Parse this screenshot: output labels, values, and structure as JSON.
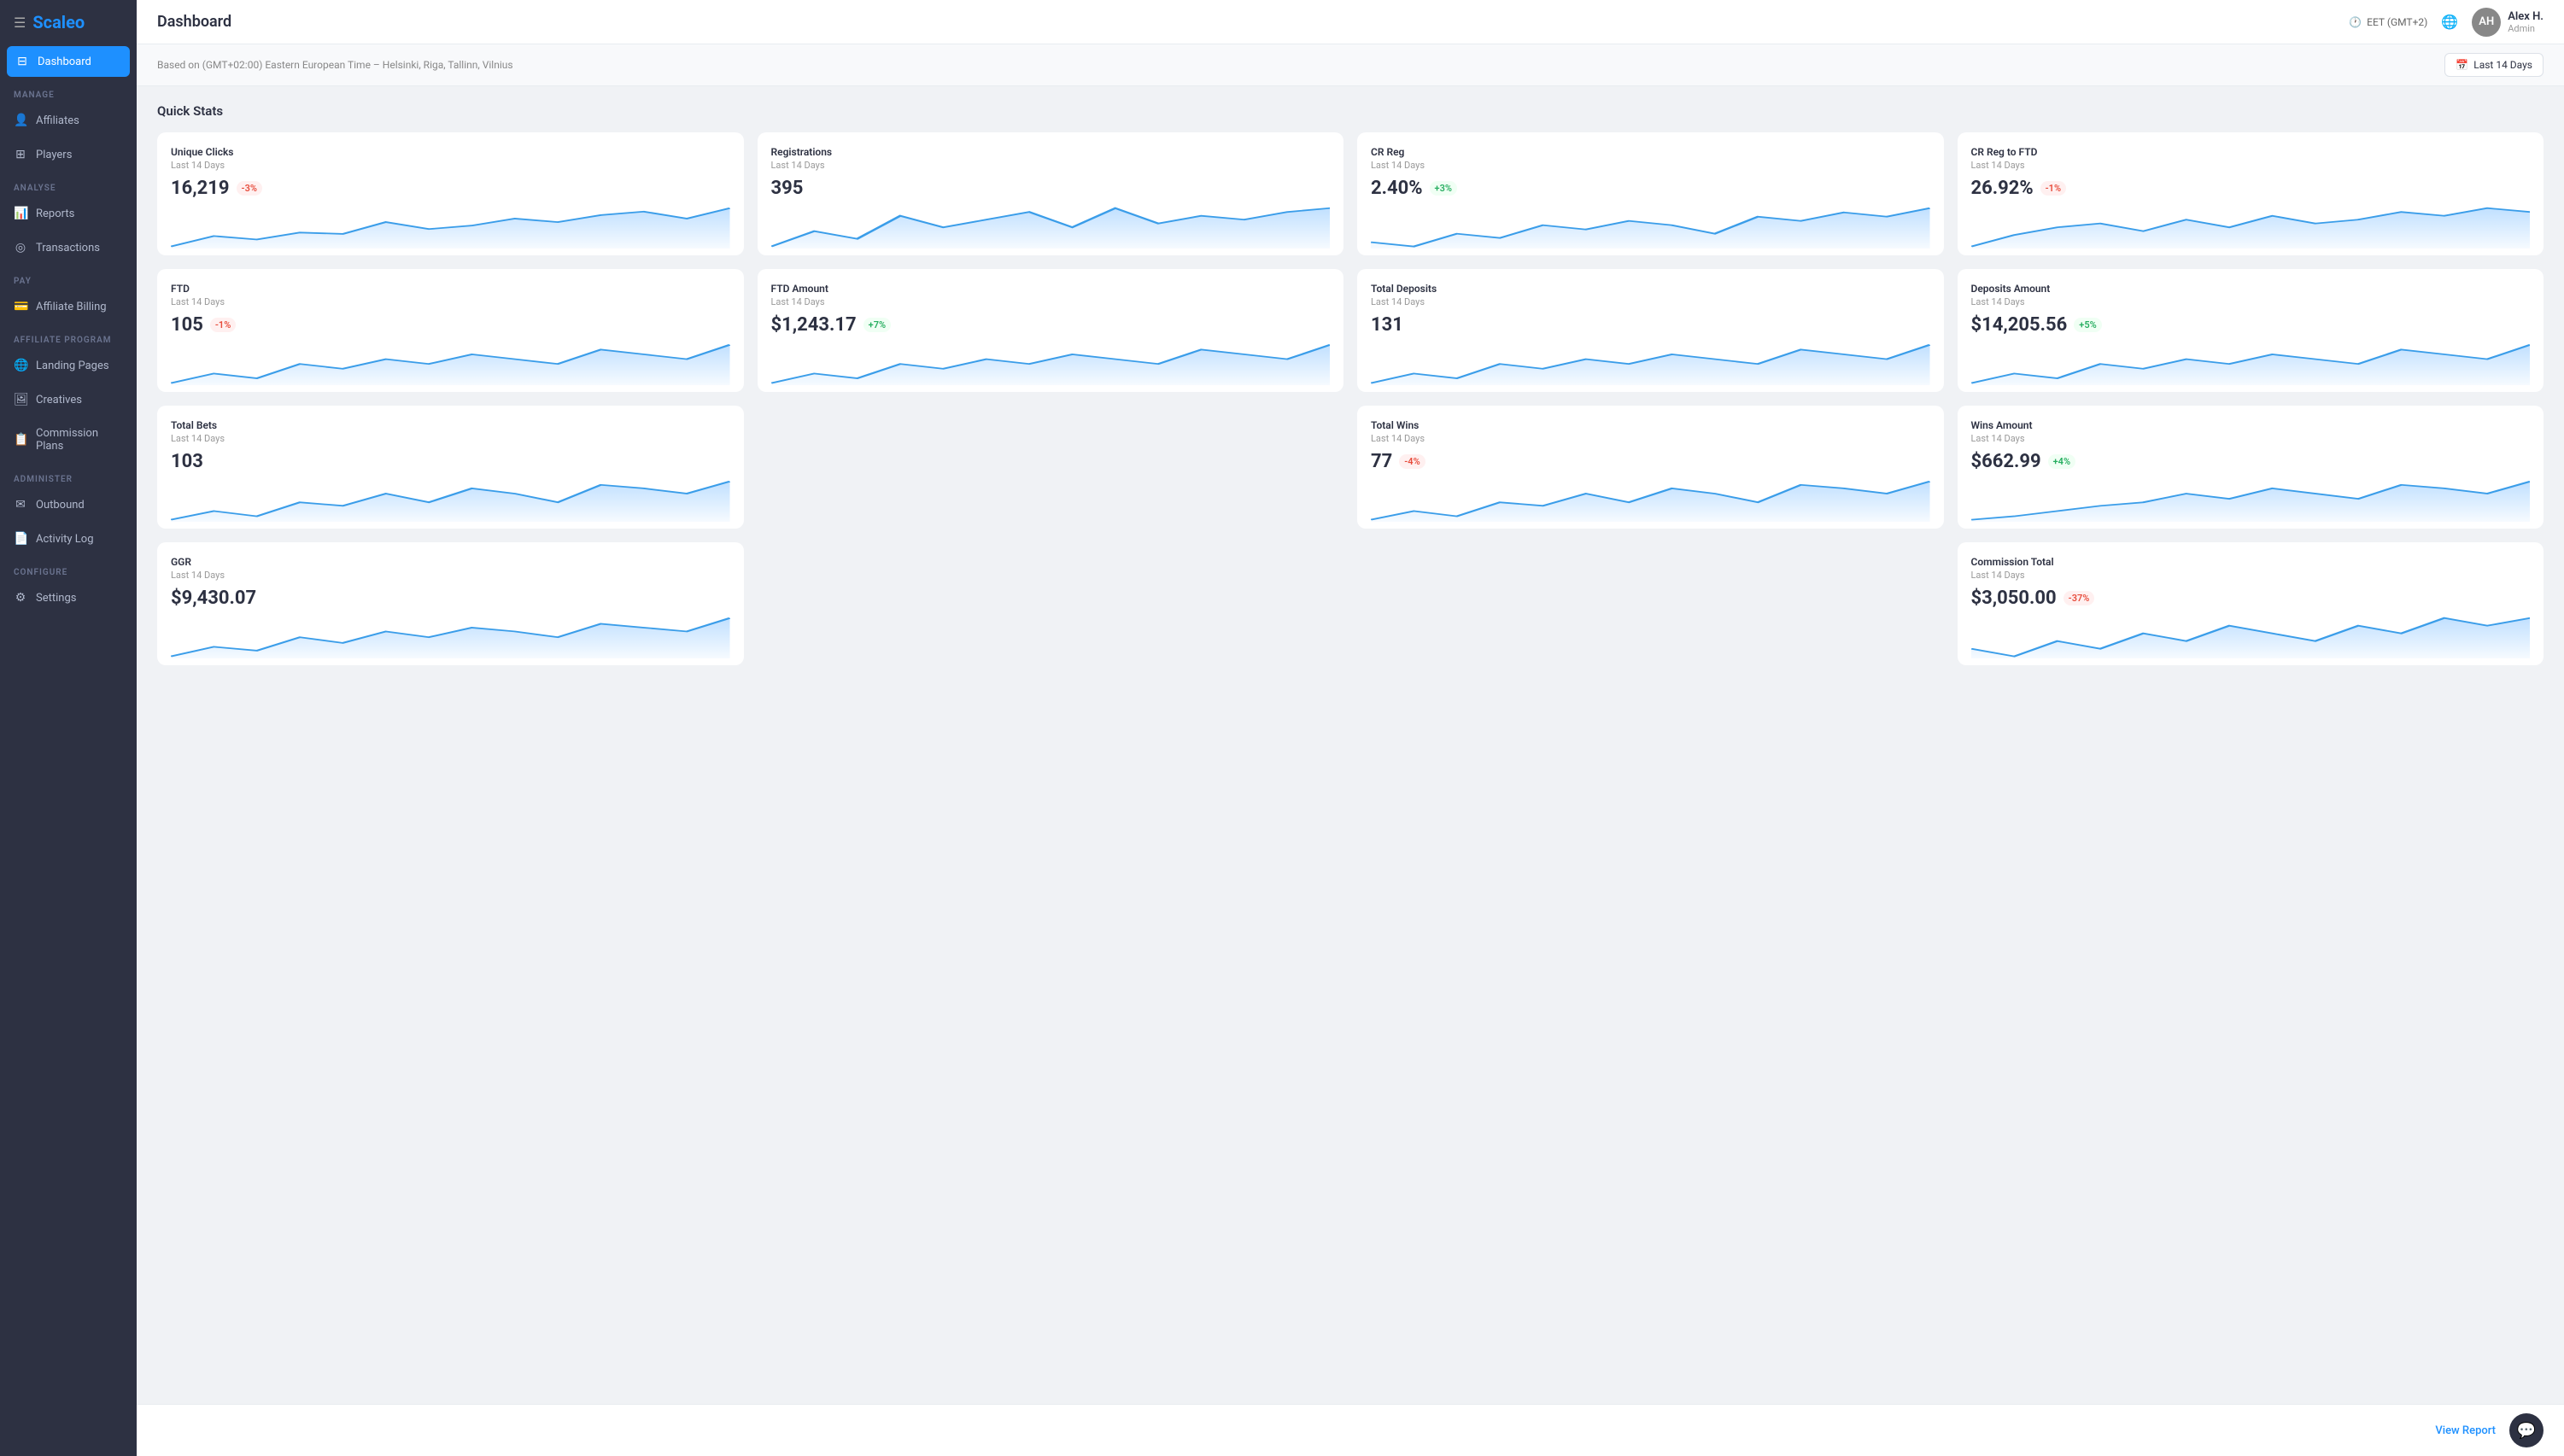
{
  "app": {
    "logo": "Scaleo",
    "hamburger": "☰"
  },
  "header": {
    "title": "Dashboard",
    "timezone": "EET (GMT+2)",
    "timezone_icon": "🕐",
    "globe_icon": "🌐",
    "user": {
      "name": "Alex H.",
      "role": "Admin",
      "initials": "AH"
    },
    "date_range": "Last 14 Days",
    "calendar_icon": "📅",
    "subtitle": "Based on (GMT+02:00) Eastern European Time – Helsinki, Riga, Tallinn, Vilnius"
  },
  "sidebar": {
    "sections": [
      {
        "label": "MANAGE",
        "items": [
          {
            "id": "affiliates",
            "label": "Affiliates",
            "icon": "👤"
          },
          {
            "id": "players",
            "label": "Players",
            "icon": "⊞"
          }
        ]
      },
      {
        "label": "ANALYSE",
        "items": [
          {
            "id": "reports",
            "label": "Reports",
            "icon": "📊"
          },
          {
            "id": "transactions",
            "label": "Transactions",
            "icon": "◎"
          }
        ]
      },
      {
        "label": "PAY",
        "items": [
          {
            "id": "affiliate-billing",
            "label": "Affiliate Billing",
            "icon": "💳"
          }
        ]
      },
      {
        "label": "AFFILIATE PROGRAM",
        "items": [
          {
            "id": "landing-pages",
            "label": "Landing Pages",
            "icon": "🌐"
          },
          {
            "id": "creatives",
            "label": "Creatives",
            "icon": "🖼"
          },
          {
            "id": "commission-plans",
            "label": "Commission Plans",
            "icon": "📋"
          }
        ]
      },
      {
        "label": "ADMINISTER",
        "items": [
          {
            "id": "outbound",
            "label": "Outbound",
            "icon": "✉"
          },
          {
            "id": "activity-log",
            "label": "Activity Log",
            "icon": "📄"
          }
        ]
      },
      {
        "label": "CONFIGURE",
        "items": [
          {
            "id": "settings",
            "label": "Settings",
            "icon": "⚙"
          }
        ]
      }
    ]
  },
  "quick_stats": {
    "title": "Quick Stats",
    "cards": [
      {
        "id": "unique-clicks",
        "label": "Unique Clicks",
        "period": "Last 14 Days",
        "value": "16,219",
        "badge": "-3%",
        "badge_type": "red",
        "chart_max": 1600,
        "chart_points": [
          20,
          35,
          30,
          40,
          38,
          55,
          45,
          50,
          60,
          55,
          65,
          70,
          60,
          75
        ]
      },
      {
        "id": "registrations",
        "label": "Registrations",
        "period": "Last 14 Days",
        "value": "395",
        "badge": "",
        "badge_type": "",
        "chart_max": 80,
        "chart_points": [
          20,
          40,
          30,
          60,
          45,
          55,
          65,
          45,
          70,
          50,
          60,
          55,
          65,
          70
        ]
      },
      {
        "id": "cr-reg",
        "label": "CR Reg",
        "period": "Last 14 Days",
        "value": "2.40%",
        "badge": "+3%",
        "badge_type": "green",
        "chart_max": 8,
        "chart_points": [
          30,
          25,
          40,
          35,
          50,
          45,
          55,
          50,
          40,
          60,
          55,
          65,
          60,
          70
        ]
      },
      {
        "id": "cr-reg-ftd",
        "label": "CR Reg to FTD",
        "period": "Last 14 Days",
        "value": "26.92%",
        "badge": "-1%",
        "badge_type": "red",
        "chart_max": 100,
        "chart_points": [
          40,
          55,
          65,
          70,
          60,
          75,
          65,
          80,
          70,
          75,
          85,
          80,
          90,
          85
        ]
      },
      {
        "id": "ftd",
        "label": "FTD",
        "period": "Last 14 Days",
        "value": "105",
        "badge": "-1%",
        "badge_type": "red",
        "chart_max": 20,
        "chart_points": [
          20,
          30,
          25,
          40,
          35,
          45,
          40,
          50,
          45,
          40,
          55,
          50,
          45,
          60
        ]
      },
      {
        "id": "ftd-amount",
        "label": "FTD Amount",
        "period": "Last 14 Days",
        "value": "$1,243.17",
        "badge": "+7%",
        "badge_type": "green",
        "chart_max": 2000,
        "chart_points": [
          30,
          40,
          35,
          50,
          45,
          55,
          50,
          60,
          55,
          50,
          65,
          60,
          55,
          70
        ]
      },
      {
        "id": "total-deposits",
        "label": "Total Deposits",
        "period": "Last 14 Days",
        "value": "131",
        "badge": "",
        "badge_type": "",
        "chart_max": 20,
        "chart_points": [
          25,
          35,
          30,
          45,
          40,
          50,
          45,
          55,
          50,
          45,
          60,
          55,
          50,
          65
        ]
      },
      {
        "id": "deposits-amount",
        "label": "Deposits Amount",
        "period": "Last 14 Days",
        "value": "$14,205.56",
        "badge": "+5%",
        "badge_type": "green",
        "chart_max": 3000,
        "chart_points": [
          60,
          70,
          65,
          80,
          75,
          85,
          80,
          90,
          85,
          80,
          95,
          90,
          85,
          100
        ]
      },
      {
        "id": "total-bets",
        "label": "Total Bets",
        "period": "Last 14 Days",
        "value": "103",
        "badge": "",
        "badge_type": "",
        "chart_max": 1600,
        "chart_points": [
          20,
          25,
          22,
          30,
          28,
          35,
          30,
          38,
          35,
          30,
          40,
          38,
          35,
          42
        ]
      },
      {
        "id": "total-wins",
        "label": "Total Wins",
        "period": "Last 14 Days",
        "value": "77",
        "badge": "-4%",
        "badge_type": "red",
        "chart_max": 12,
        "chart_points": [
          30,
          35,
          32,
          40,
          38,
          45,
          40,
          48,
          45,
          40,
          50,
          48,
          45,
          52
        ]
      },
      {
        "id": "wins-amount",
        "label": "Wins Amount",
        "period": "Last 14 Days",
        "value": "$662.99",
        "badge": "+4%",
        "badge_type": "green",
        "chart_max": 100,
        "chart_points": [
          20,
          22,
          25,
          28,
          30,
          35,
          32,
          38,
          35,
          32,
          40,
          38,
          35,
          42
        ]
      },
      {
        "id": "ggr",
        "label": "GGR",
        "period": "Last 14 Days",
        "value": "$9,430.07",
        "badge": "",
        "badge_type": "",
        "chart_max": 4,
        "chart_points": [
          25,
          30,
          28,
          35,
          32,
          38,
          35,
          40,
          38,
          35,
          42,
          40,
          38,
          45
        ]
      },
      {
        "id": "commission-total",
        "label": "Commission Total",
        "period": "Last 14 Days",
        "value": "$3,050.00",
        "badge": "-37%",
        "badge_type": "red",
        "chart_max": 1000,
        "chart_points": [
          60,
          55,
          65,
          60,
          70,
          65,
          75,
          70,
          65,
          75,
          70,
          80,
          75,
          80
        ]
      }
    ]
  },
  "bottom": {
    "view_report": "View Report",
    "chat_icon": "💬"
  }
}
